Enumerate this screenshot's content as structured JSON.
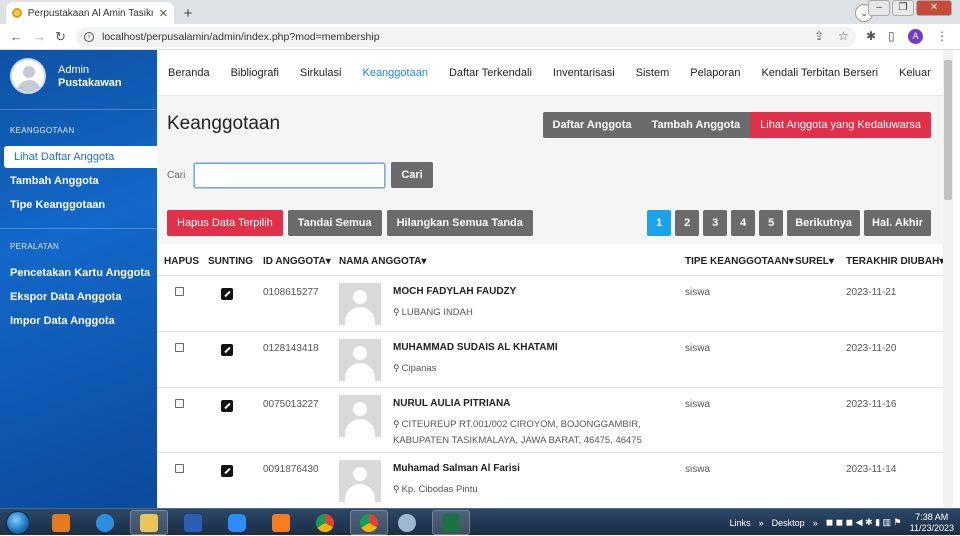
{
  "browser": {
    "tab_title": "Perpustakaan Al Amin Tasikmalaya",
    "url": "localhost/perpusalamin/admin/index.php?mod=membership",
    "profile_initial": "A"
  },
  "sidebar": {
    "user_name": "Admin",
    "user_role": "Pustakawan",
    "section1": "KEANGGOTAAN",
    "items1": [
      "Lihat Daftar Anggota",
      "Tambah Anggota",
      "Tipe Keanggotaan"
    ],
    "section2": "PERALATAN",
    "items2": [
      "Pencetakan Kartu Anggota",
      "Ekspor Data Anggota",
      "Impor Data Anggota"
    ]
  },
  "topnav": [
    "Beranda",
    "Bibliografi",
    "Sirkulasi",
    "Keanggotaan",
    "Daftar Terkendali",
    "Inventarisasi",
    "Sistem",
    "Pelaporan",
    "Kendali Terbitan Berseri",
    "Keluar"
  ],
  "page": {
    "title": "Keanggotaan",
    "actions": [
      "Daftar Anggota",
      "Tambah Anggota",
      "Lihat Anggota yang Kedaluwarsa"
    ],
    "search_label": "Cari",
    "search_value": "",
    "search_button": "Cari",
    "toolbar": [
      "Hapus Data Terpilih",
      "Tandai Semua",
      "Hilangkan Semua Tanda"
    ],
    "pager": [
      "1",
      "2",
      "3",
      "4",
      "5",
      "Berikutnya",
      "Hal. Akhir"
    ],
    "colors": {
      "danger": "#e0314a",
      "neutral": "#6b6b6b",
      "primary": "#1ba3e8",
      "sidebar": "#1268c9"
    }
  },
  "table": {
    "headers": [
      "HAPUS",
      "SUNTING",
      "ID ANGGOTA",
      "NAMA ANGGOTA",
      "TIPE KEANGGOTAAN",
      "SUREL",
      "TERAKHIR DIUBAH"
    ],
    "rows": [
      {
        "id": "0108615277",
        "name": "MOCH FADYLAH FAUDZY",
        "address": "LUBANG INDAH",
        "type": "siswa",
        "date": "2023-11-21"
      },
      {
        "id": "0128143418",
        "name": "MUHAMMAD SUDAIS AL KHATAMI",
        "address": "Cipanas",
        "type": "siswa",
        "date": "2023-11-20"
      },
      {
        "id": "0075013227",
        "name": "NURUL AULIA PITRIANA",
        "address": "CITEUREUP RT.001/002 CIROYOM, BOJONGGAMBIR, KABUPATEN TASIKMALAYA, JAWA BARAT, 46475, 46475",
        "type": "siswa",
        "date": "2023-11-16"
      },
      {
        "id": "0091876430",
        "name": "Muhamad Salman Al Farisi",
        "address": "Kp. Cibodas Pintu",
        "type": "siswa",
        "date": "2023-11-14"
      }
    ]
  },
  "taskbar": {
    "links": "Links",
    "desktop": "Desktop",
    "time": "7:38 AM",
    "date": "11/23/2023"
  }
}
